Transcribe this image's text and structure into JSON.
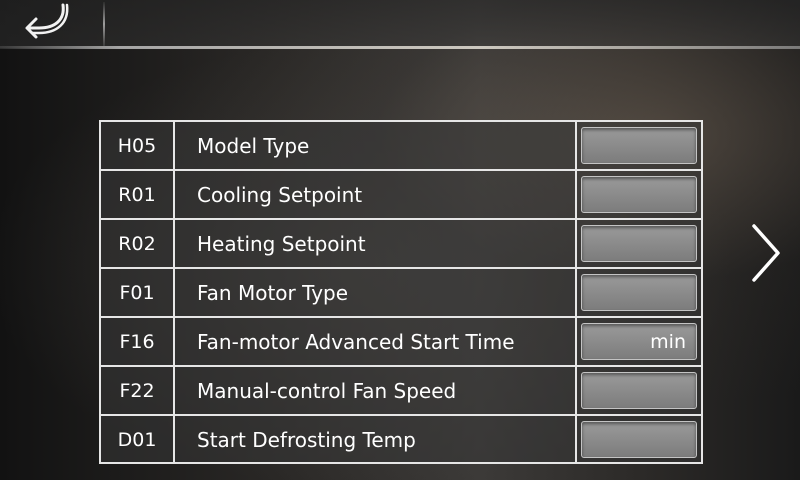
{
  "header": {
    "back_icon": "back-arrow-icon"
  },
  "navigation": {
    "next_icon": "chevron-right-icon"
  },
  "parameters": [
    {
      "code": "H05",
      "label": "Model Type",
      "value": ""
    },
    {
      "code": "R01",
      "label": "Cooling Setpoint",
      "value": ""
    },
    {
      "code": "R02",
      "label": "Heating Setpoint",
      "value": ""
    },
    {
      "code": "F01",
      "label": "Fan Motor Type",
      "value": ""
    },
    {
      "code": "F16",
      "label": "Fan-motor Advanced Start Time",
      "value": "min"
    },
    {
      "code": "F22",
      "label": "Manual-control Fan Speed",
      "value": ""
    },
    {
      "code": "D01",
      "label": "Start Defrosting Temp",
      "value": ""
    }
  ],
  "colors": {
    "table_border": "#e6e6e6",
    "value_box": "#8a8a8a",
    "text": "#ffffff"
  }
}
